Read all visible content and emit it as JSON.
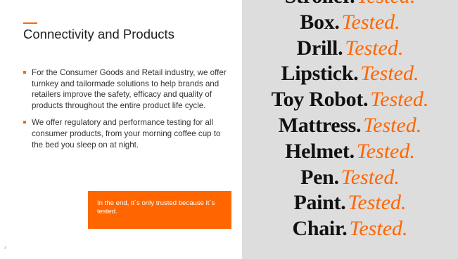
{
  "slide": {
    "title": "Connectivity and Products",
    "bullets": [
      "For the Consumer Goods and Retail industry, we offer turnkey and tailormade solutions to help brands and retailers improve the safety, efficacy and quality of products throughout the entire product life cycle.",
      "We offer regulatory and performance testing for all consumer products, from your morning coffee cup to the bed you sleep on at night."
    ],
    "callout": "In the end, it´s only trusted because it´s tested.",
    "page_number": "3"
  },
  "tested_panel": {
    "suffix": "Tested.",
    "items": [
      "Stroller.",
      "Box.",
      "Drill.",
      "Lipstick.",
      "Toy Robot.",
      "Mattress.",
      "Helmet.",
      "Pen.",
      "Paint.",
      "Chair."
    ]
  },
  "colors": {
    "accent": "#ff6600",
    "panel_background": "#dddddd",
    "text_dark": "#111111"
  }
}
